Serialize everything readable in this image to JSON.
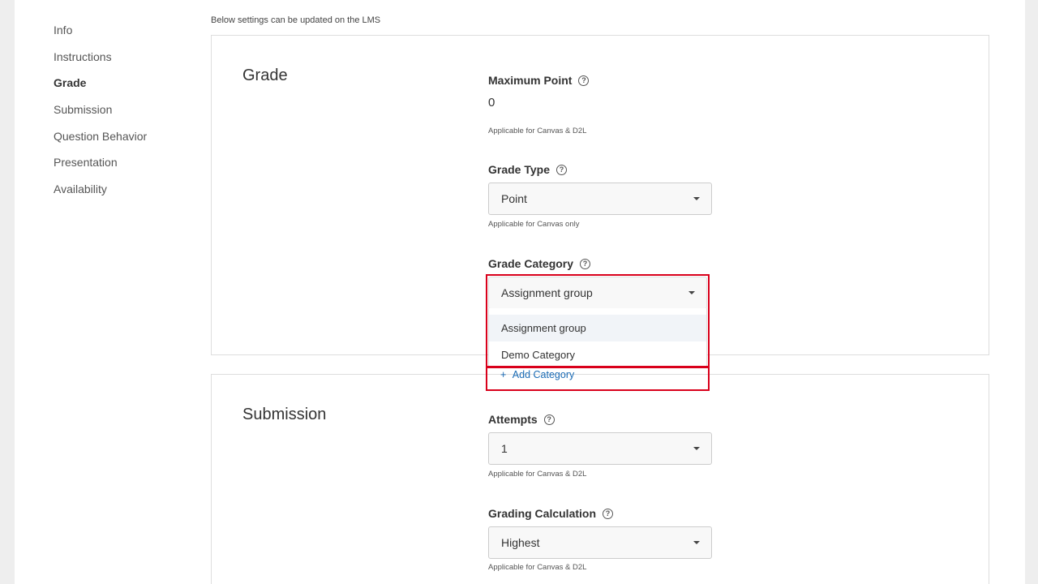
{
  "sidebar": {
    "items": [
      {
        "label": "Info"
      },
      {
        "label": "Instructions"
      },
      {
        "label": "Grade"
      },
      {
        "label": "Submission"
      },
      {
        "label": "Question Behavior"
      },
      {
        "label": "Presentation"
      },
      {
        "label": "Availability"
      }
    ],
    "active": "Grade"
  },
  "top_note": "Below settings can be updated on the LMS",
  "grade": {
    "title": "Grade",
    "max_point": {
      "label": "Maximum Point",
      "value": "0",
      "hint": "Applicable for Canvas & D2L"
    },
    "grade_type": {
      "label": "Grade Type",
      "value": "Point",
      "hint": "Applicable for Canvas only"
    },
    "grade_category": {
      "label": "Grade Category",
      "value": "Assignment group",
      "options": [
        "Assignment group",
        "Demo Category"
      ],
      "add_label": "Add Category",
      "add_icon": "+"
    }
  },
  "submission": {
    "title": "Submission",
    "attempts": {
      "label": "Attempts",
      "value": "1",
      "hint": "Applicable for Canvas & D2L"
    },
    "grading_calc": {
      "label": "Grading Calculation",
      "value": "Highest",
      "hint": "Applicable for Canvas & D2L"
    }
  },
  "icons": {
    "help": "?"
  },
  "colors": {
    "highlight": "#d9001b",
    "link": "#1a6bb5"
  }
}
